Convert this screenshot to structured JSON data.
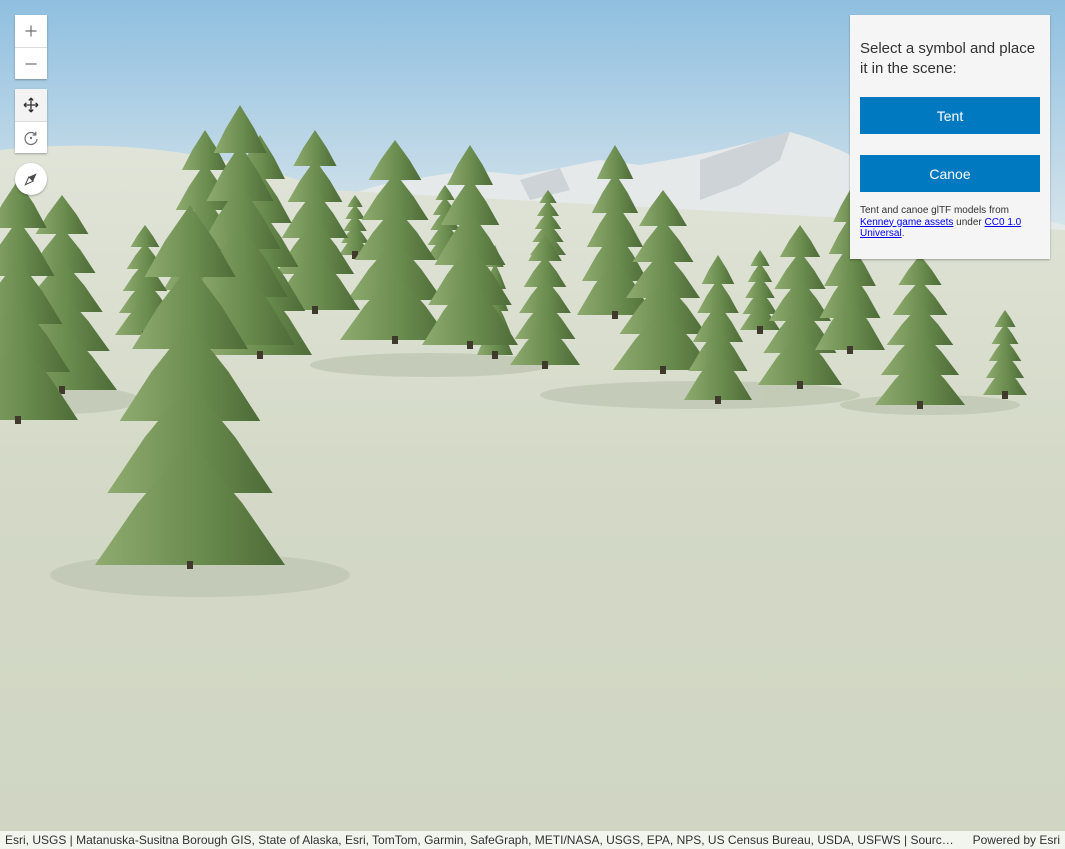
{
  "view_controls": {
    "zoom_in": {
      "icon": "plus-icon",
      "label": "+"
    },
    "zoom_out": {
      "icon": "minus-icon",
      "label": "–"
    },
    "pan_mode": {
      "icon": "pan-icon",
      "active": true
    },
    "rotate_mode": {
      "icon": "rotate-icon",
      "active": false
    },
    "compass": {
      "icon": "compass-icon"
    }
  },
  "panel": {
    "title": "Select a symbol and place it in the scene:",
    "buttons": [
      {
        "label": "Tent"
      },
      {
        "label": "Canoe"
      }
    ],
    "credit": {
      "prefix": "Tent and canoe glTF models from ",
      "link1": "Kenney game assets",
      "middle": " under ",
      "link2": "CC0 1.0 Universal",
      "suffix": "."
    },
    "accent_color": "#0079c1"
  },
  "attribution": {
    "sources": "Esri, USGS | Matanuska-Susitna Borough GIS, State of Alaska, Esri, TomTom, Garmin, SafeGraph, METI/NASA, USGS, EPA, NPS, US Census Bureau, USDA, USFWS | Source: Airbus, USGS, NGA, NASA, CGIAR, NLS, OS, NMA, Geodatastyrelsen, GSA, GSI and the GIS User Community",
    "powered_by_prefix": "Powered by ",
    "powered_by_link": "Esri"
  },
  "scene": {
    "sky_color": "#a9cde6",
    "ground_color": "#d3d9c8",
    "tree_color": "#6f9154",
    "mountain_color": "#e3e7e8"
  }
}
